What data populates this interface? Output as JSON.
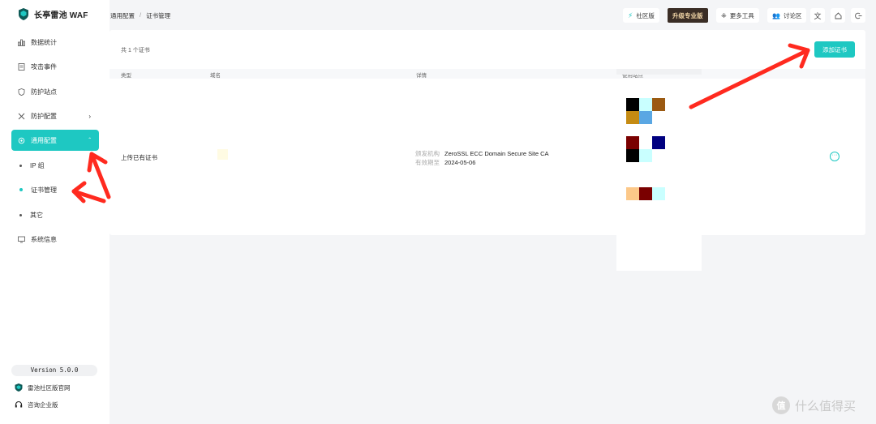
{
  "app": {
    "title": "长亭雷池 WAF"
  },
  "sidebar": {
    "items": [
      {
        "label": "数据统计",
        "icon": "bar-chart-icon"
      },
      {
        "label": "攻击事件",
        "icon": "document-icon"
      },
      {
        "label": "防护站点",
        "icon": "shield-icon"
      },
      {
        "label": "防护配置",
        "icon": "tools-icon"
      },
      {
        "label": "通用配置",
        "icon": "gear-icon"
      },
      {
        "label": "系统信息",
        "icon": "monitor-icon"
      }
    ],
    "sub_items": [
      {
        "label": "IP 组"
      },
      {
        "label": "证书管理"
      },
      {
        "label": "其它"
      }
    ],
    "version": "Version 5.0.0",
    "footer_links": [
      {
        "label": "雷池社区版官网"
      },
      {
        "label": "咨询企业版"
      }
    ]
  },
  "breadcrumb": {
    "parent": "通用配置",
    "current": "证书管理"
  },
  "topbar": {
    "community": "社区版",
    "upgrade": "升级专业版",
    "more_tools": "更多工具",
    "discuss": "讨论区"
  },
  "main": {
    "count_text": "共 1 个证书",
    "add_button": "添加证书",
    "columns": [
      "类型",
      "域名",
      "详情",
      "使用站点"
    ],
    "rows": [
      {
        "type": "上传已有证书",
        "issuer_label": "颁发机构",
        "issuer": "ZeroSSL ECC Domain Secure Site CA",
        "expiry_label": "有效期至",
        "expiry": "2024-05-06"
      }
    ]
  },
  "watermark": {
    "text": "什么值得买",
    "logo": "值"
  },
  "colors": {
    "accent": "#1ec8c2",
    "annotation_arrow": "#ff2a1f",
    "upgrade_bg": "#3a2d25",
    "upgrade_text": "#f3d7a8"
  }
}
